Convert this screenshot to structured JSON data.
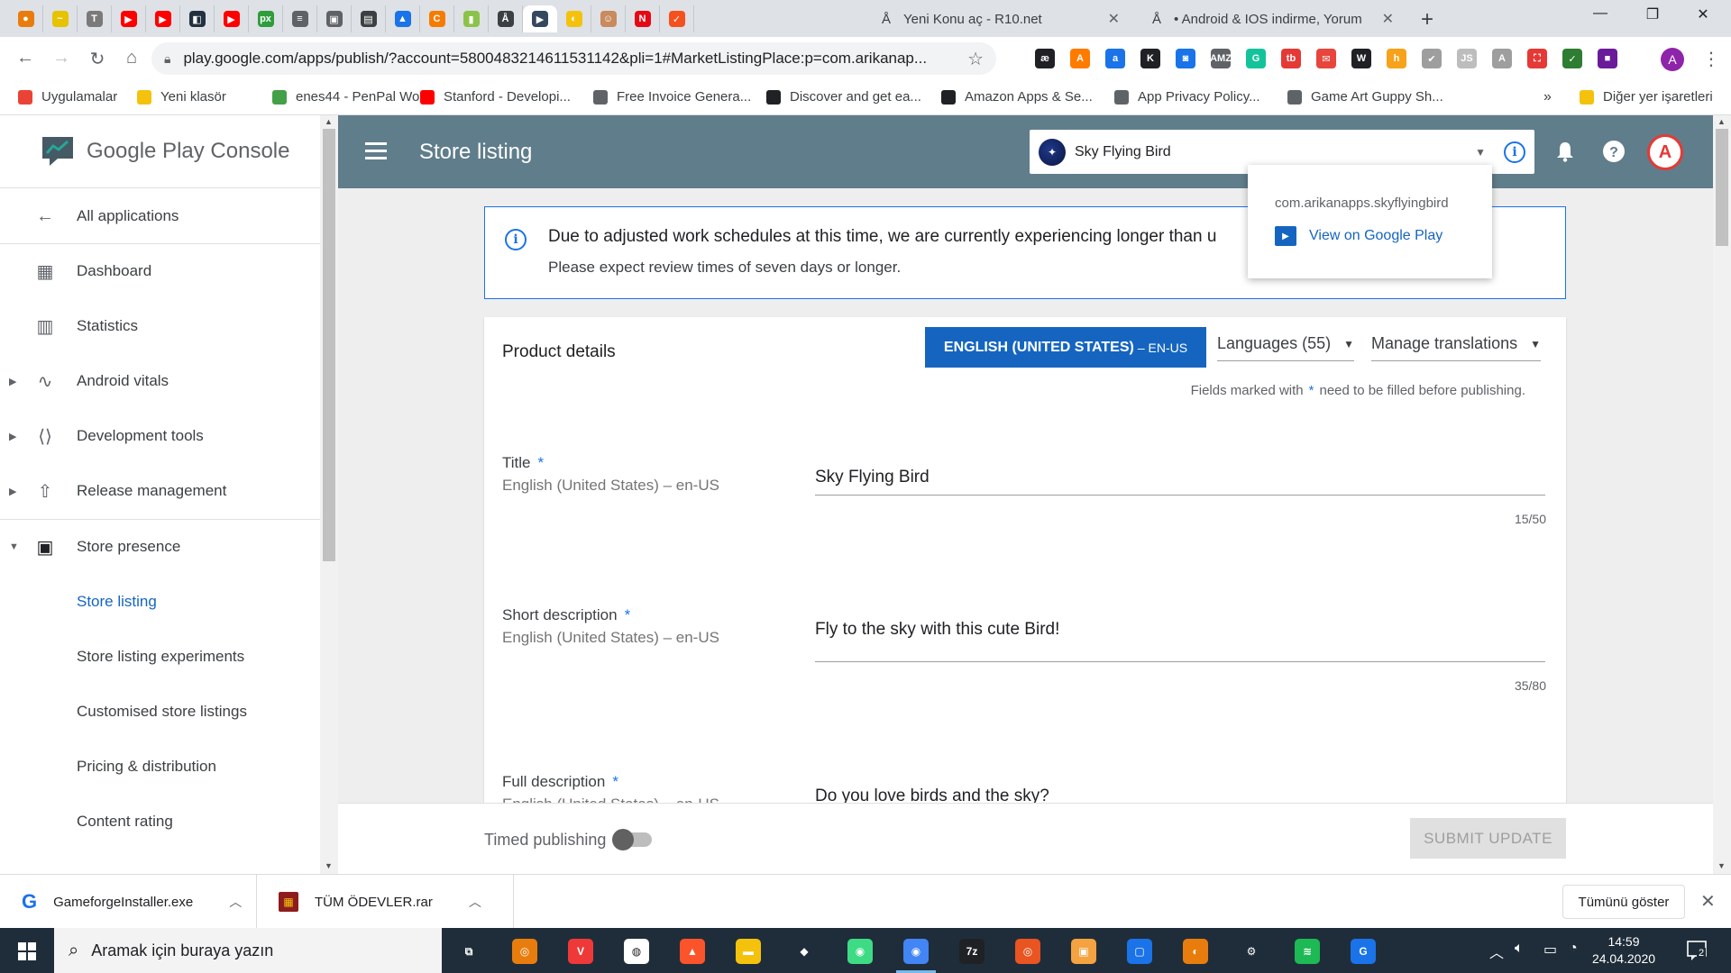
{
  "browser": {
    "pinned_tabs": [
      {
        "icon": "blender-icon",
        "color": "#e87d0d",
        "glyph": "●"
      },
      {
        "icon": "feather-icon",
        "color": "#e6c200",
        "glyph": "~"
      },
      {
        "icon": "doc-icon",
        "color": "#7a7a7a",
        "glyph": "T"
      },
      {
        "icon": "youtube-icon",
        "color": "#ff0000",
        "glyph": "▶"
      },
      {
        "icon": "youtube-icon",
        "color": "#ff0000",
        "glyph": "▶"
      },
      {
        "icon": "vscode-icon",
        "color": "#23313f",
        "glyph": "◧"
      },
      {
        "icon": "youtube-icon",
        "color": "#ff0000",
        "glyph": "▶"
      },
      {
        "icon": "px-icon",
        "color": "#2e9d3b",
        "glyph": "px"
      },
      {
        "icon": "docs-icon",
        "color": "#5f6368",
        "glyph": "≡"
      },
      {
        "icon": "image-icon",
        "color": "#5f6368",
        "glyph": "▣"
      },
      {
        "icon": "save-icon",
        "color": "#3c4043",
        "glyph": "▤"
      },
      {
        "icon": "drive-icon",
        "color": "#1a73e8",
        "glyph": "▲"
      },
      {
        "icon": "cyclic-icon",
        "color": "#f57c00",
        "glyph": "C"
      },
      {
        "icon": "bar-icon",
        "color": "#8bc34a",
        "glyph": "▮"
      },
      {
        "icon": "unity-icon",
        "color": "#3c4043",
        "glyph": "Å"
      },
      {
        "icon": "play-console-icon",
        "color": "#34495e",
        "glyph": "▶"
      },
      {
        "icon": "banana-icon",
        "color": "#f4c20d",
        "glyph": "◐"
      },
      {
        "icon": "face-icon",
        "color": "#c98a5d",
        "glyph": "☺"
      },
      {
        "icon": "netflix-icon",
        "color": "#e50914",
        "glyph": "N"
      },
      {
        "icon": "check-icon",
        "color": "#f4511e",
        "glyph": "✓"
      }
    ],
    "tabs": [
      {
        "title": "Yeni Konu aç - R10.net",
        "icon": "unity-icon"
      },
      {
        "title": "• Android & IOS indirme, Yorum",
        "icon": "unity-icon"
      }
    ],
    "url": "play.google.com/apps/publish/?account=5800483214611531142&pli=1#MarketListingPlace:p=com.arikanap...",
    "profile_initial": "A",
    "extensions": [
      {
        "icon": "ae-icon",
        "glyph": "æ",
        "color": "#202124"
      },
      {
        "icon": "ahrefs-icon",
        "glyph": "A",
        "color": "#ff7b00"
      },
      {
        "icon": "a-icon",
        "glyph": "a",
        "color": "#1a73e8"
      },
      {
        "icon": "k-icon",
        "glyph": "K",
        "color": "#202124"
      },
      {
        "icon": "screen-icon",
        "glyph": "◙",
        "color": "#1a73e8"
      },
      {
        "icon": "amz-icon",
        "glyph": "AMZ",
        "color": "#5f6368"
      },
      {
        "icon": "grammarly-icon",
        "glyph": "G",
        "color": "#15c39a"
      },
      {
        "icon": "tb-icon",
        "glyph": "tb",
        "color": "#e53935"
      },
      {
        "icon": "mail-icon",
        "glyph": "✉",
        "color": "#e8453c"
      },
      {
        "icon": "w-icon",
        "glyph": "W",
        "color": "#202124"
      },
      {
        "icon": "honey-icon",
        "glyph": "h",
        "color": "#f7a21b"
      },
      {
        "icon": "tick-icon",
        "glyph": "✔",
        "color": "#9e9e9e"
      },
      {
        "icon": "js-icon",
        "glyph": "JS",
        "color": "#bdbdbd"
      },
      {
        "icon": "font-icon",
        "glyph": "A",
        "color": "#9e9e9e"
      },
      {
        "icon": "pdf-icon",
        "glyph": "⛶",
        "color": "#e53935"
      },
      {
        "icon": "shield-icon",
        "glyph": "✓",
        "color": "#2e7d32"
      },
      {
        "icon": "purple-icon",
        "glyph": "■",
        "color": "#6a1b9a"
      }
    ]
  },
  "bookmarks": [
    {
      "label": "Uygulamalar",
      "icon": "apps-grid-icon",
      "color": "#ea4335"
    },
    {
      "label": "Yeni klasör",
      "icon": "folder-icon",
      "color": "#f4c20d"
    },
    {
      "label": "enes44 - PenPal Wo...",
      "icon": "leaf-icon",
      "color": "#43a047"
    },
    {
      "label": "Stanford - Developi...",
      "icon": "youtube-icon",
      "color": "#ff0000"
    },
    {
      "label": "Free Invoice Genera...",
      "icon": "globe-icon",
      "color": "#5f6368"
    },
    {
      "label": "Discover and get ea...",
      "icon": "lines-icon",
      "color": "#202124"
    },
    {
      "label": "Amazon Apps & Se...",
      "icon": "amazon-icon",
      "color": "#202124"
    },
    {
      "label": "App Privacy Policy...",
      "icon": "doc-icon",
      "color": "#5f6368"
    },
    {
      "label": "Game Art Guppy Sh...",
      "icon": "globe-icon",
      "color": "#5f6368"
    }
  ],
  "bookmarks_more": "»",
  "bookmarks_other": "Diğer yer işaretleri",
  "sidebar": {
    "logo": "Google Play Console",
    "items": [
      {
        "label": "All applications",
        "icon": "arrow-left-icon"
      },
      {
        "label": "Dashboard",
        "icon": "dashboard-icon"
      },
      {
        "label": "Statistics",
        "icon": "bar-chart-icon"
      },
      {
        "label": "Android vitals",
        "icon": "pulse-icon"
      },
      {
        "label": "Development tools",
        "icon": "code-icon"
      },
      {
        "label": "Release management",
        "icon": "rocket-icon"
      },
      {
        "label": "Store presence",
        "icon": "store-bag-icon"
      },
      {
        "label": "Store listing",
        "icon": ""
      },
      {
        "label": "Store listing experiments",
        "icon": ""
      },
      {
        "label": "Customised store listings",
        "icon": ""
      },
      {
        "label": "Pricing & distribution",
        "icon": ""
      },
      {
        "label": "Content rating",
        "icon": ""
      }
    ]
  },
  "appbar": {
    "title": "Store listing",
    "app_name": "Sky Flying Bird"
  },
  "popup": {
    "package": "com.arikanapps.skyflyingbird",
    "link": "View on Google Play"
  },
  "notice": {
    "title": "Due to adjusted work schedules at this time, we are currently experiencing longer than u",
    "body": "Please expect review times of seven days or longer."
  },
  "product": {
    "heading": "Product details",
    "language_button": "ENGLISH (UNITED STATES)",
    "language_code": "– EN-US",
    "languages_dropdown": "Languages (55)",
    "manage_translations": "Manage translations",
    "required_note_pre": "Fields marked with",
    "required_note_star": "*",
    "required_note_post": "need to be filled before publishing.",
    "fields": [
      {
        "label": "Title",
        "sub": "English (United States) – en-US",
        "value": "Sky Flying Bird",
        "count": "15/50"
      },
      {
        "label": "Short description",
        "sub": "English (United States) – en-US",
        "value": "Fly to the sky with this cute Bird!",
        "count": "35/80"
      },
      {
        "label": "Full description",
        "sub": "English (United States) – en-US",
        "value": "Do you love birds and the sky?",
        "count": ""
      }
    ]
  },
  "bottom": {
    "timed_publishing": "Timed publishing",
    "submit": "SUBMIT UPDATE"
  },
  "downloads": [
    {
      "name": "GameforgeInstaller.exe",
      "icon": "gameforge-icon"
    },
    {
      "name": "TÜM ÖDEVLER.rar",
      "icon": "winrar-icon"
    }
  ],
  "downloads_show_all": "Tümünü göster",
  "taskbar": {
    "search_placeholder": "Aramak için buraya yazın",
    "time": "14:59",
    "date": "24.04.2020",
    "notifications": "2"
  }
}
